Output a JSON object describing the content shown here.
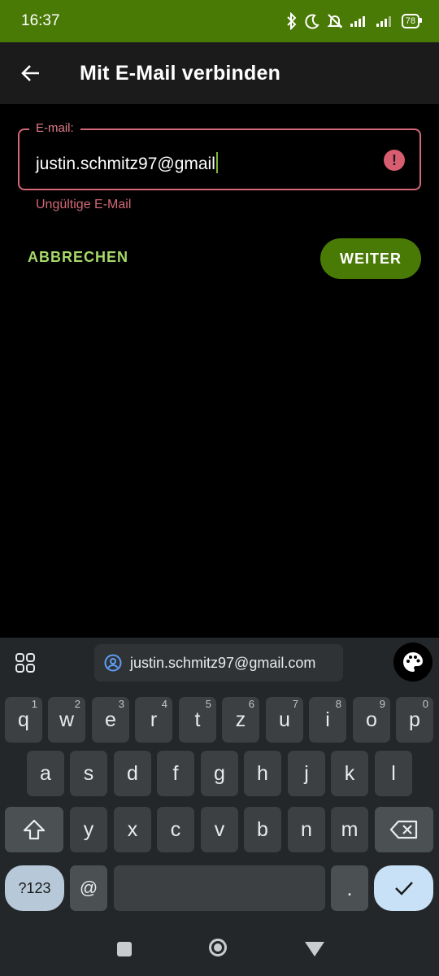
{
  "status_bar": {
    "time": "16:37",
    "battery": "78"
  },
  "app_bar": {
    "title": "Mit E-Mail verbinden"
  },
  "form": {
    "email_label": "E-mail:",
    "email_value": "justin.schmitz97@gmail",
    "error_message": "Ungültige E-Mail",
    "error_icon_glyph": "!",
    "cancel_label": "ABBRECHEN",
    "next_label": "WEITER"
  },
  "colors": {
    "status_bar": "#4a7a06",
    "accent_button": "#4a7a06",
    "error": "#d36876",
    "cancel_text": "#a6d96a"
  },
  "keyboard": {
    "suggestion": "justin.schmitz97@gmail.com",
    "row1": [
      {
        "key": "q",
        "num": "1"
      },
      {
        "key": "w",
        "num": "2"
      },
      {
        "key": "e",
        "num": "3"
      },
      {
        "key": "r",
        "num": "4"
      },
      {
        "key": "t",
        "num": "5"
      },
      {
        "key": "z",
        "num": "6"
      },
      {
        "key": "u",
        "num": "7"
      },
      {
        "key": "i",
        "num": "8"
      },
      {
        "key": "o",
        "num": "9"
      },
      {
        "key": "p",
        "num": "0"
      }
    ],
    "row2": [
      "a",
      "s",
      "d",
      "f",
      "g",
      "h",
      "j",
      "k",
      "l"
    ],
    "row3": [
      "y",
      "x",
      "c",
      "v",
      "b",
      "n",
      "m"
    ],
    "row4": {
      "symbols": "?123",
      "at": "@",
      "period": "."
    }
  }
}
